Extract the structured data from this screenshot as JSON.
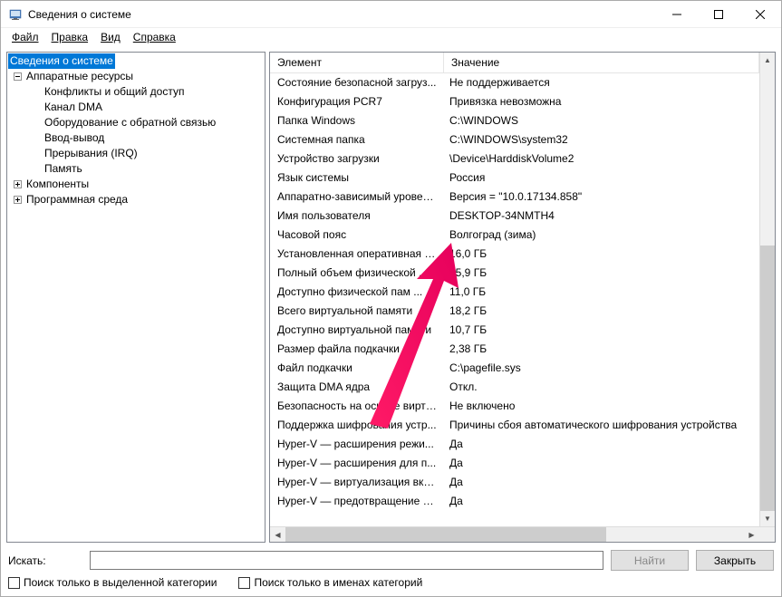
{
  "window": {
    "title": "Сведения о системе"
  },
  "menu": {
    "file": "Файл",
    "edit": "Правка",
    "view": "Вид",
    "help": "Справка"
  },
  "tree": {
    "root": "Сведения о системе",
    "hardware": "Аппаратные ресурсы",
    "hw_conflicts": "Конфликты и общий доступ",
    "hw_dma": "Канал DMA",
    "hw_forced": "Оборудование с обратной связью",
    "hw_io": "Ввод-вывод",
    "hw_irq": "Прерывания (IRQ)",
    "hw_memory": "Память",
    "components": "Компоненты",
    "software_env": "Программная среда"
  },
  "list": {
    "header_element": "Элемент",
    "header_value": "Значение",
    "rows": [
      {
        "k": "Состояние безопасной загруз...",
        "v": "Не поддерживается"
      },
      {
        "k": "Конфигурация PCR7",
        "v": "Привязка невозможна"
      },
      {
        "k": "Папка Windows",
        "v": "C:\\WINDOWS"
      },
      {
        "k": "Системная папка",
        "v": "C:\\WINDOWS\\system32"
      },
      {
        "k": "Устройство загрузки",
        "v": "\\Device\\HarddiskVolume2"
      },
      {
        "k": "Язык системы",
        "v": "Россия"
      },
      {
        "k": "Аппаратно-зависимый уровен...",
        "v": "Версия = \"10.0.17134.858\""
      },
      {
        "k": "Имя пользователя",
        "v": "DESKTOP-34NMTH4"
      },
      {
        "k": "Часовой пояс",
        "v": "Волгоград (зима)"
      },
      {
        "k": "Установленная оперативная п...",
        "v": "16,0 ГБ"
      },
      {
        "k": "Полный объем физической ...",
        "v": "15,9 ГБ"
      },
      {
        "k": "Доступно физической пам ...",
        "v": "11,0 ГБ"
      },
      {
        "k": "Всего виртуальной памяти",
        "v": "18,2 ГБ"
      },
      {
        "k": "Доступно виртуальной памяти",
        "v": "10,7 ГБ"
      },
      {
        "k": "Размер файла подкачки",
        "v": "2,38 ГБ"
      },
      {
        "k": "Файл подкачки",
        "v": "C:\\pagefile.sys"
      },
      {
        "k": "Защита DMA ядра",
        "v": "Откл."
      },
      {
        "k": "Безопасность на основе вирту...",
        "v": "Не включено"
      },
      {
        "k": "Поддержка шифрования устр...",
        "v": "Причины сбоя автоматического шифрования устройства"
      },
      {
        "k": "Hyper-V — расширения режи...",
        "v": "Да"
      },
      {
        "k": "Hyper-V — расширения для п...",
        "v": "Да"
      },
      {
        "k": "Hyper-V — виртуализация вкл...",
        "v": "Да"
      },
      {
        "k": "Hyper-V — предотвращение в...",
        "v": "Да"
      }
    ]
  },
  "search": {
    "label": "Искать:",
    "placeholder": "",
    "find_btn": "Найти",
    "close_btn": "Закрыть",
    "check_selected": "Поиск только в выделенной категории",
    "check_names": "Поиск только в именах категорий"
  }
}
